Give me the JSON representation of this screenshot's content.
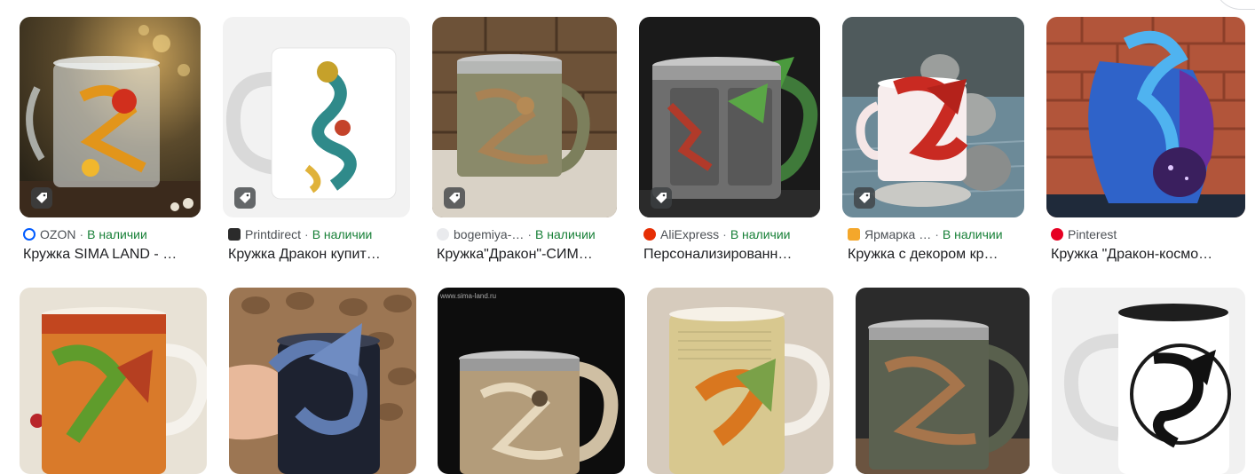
{
  "results_row_1": [
    {
      "source": "OZON",
      "stock": "В наличии",
      "title": "Кружка SIMA LAND - …",
      "image": "glass-mug-golden-dragon",
      "favicon": "ozon-icon"
    },
    {
      "source": "Printdirect",
      "stock": "В наличии",
      "title": "Кружка Дракон купит…",
      "image": "white-mug-teal-dragon",
      "favicon": "printdirect-icon"
    },
    {
      "source": "bogemiya-…",
      "stock": "В наличии",
      "title": "Кружка\"Дракон\"-СИМ…",
      "image": "stone-dragon-tankard",
      "favicon": "bogemiya-icon"
    },
    {
      "source": "AliExpress",
      "stock": "В наличии",
      "title": "Персонализированн…",
      "image": "gothic-dragon-tankard",
      "favicon": "aliexpress-icon"
    },
    {
      "source": "Ярмарка …",
      "stock": "В наличии",
      "title": "Кружка с декором кр…",
      "image": "mug-red-dragon-decor",
      "favicon": "yarmarka-icon"
    },
    {
      "source": "Pinterest",
      "stock": "",
      "title": "Кружка \"Дракон-космо…",
      "image": "blue-cosmic-dragon-mug",
      "favicon": "pinterest-icon"
    }
  ],
  "results_row_2": [
    {
      "image": "green-dragon-porcelain-mug"
    },
    {
      "image": "black-mug-blue-dragon"
    },
    {
      "image": "bone-dragon-tankard",
      "watermark": "www.sima-land.ru"
    },
    {
      "image": "orange-dragon-porcelain-mug"
    },
    {
      "image": "bronze-dragon-tankard"
    },
    {
      "image": "white-mug-black-dragon"
    }
  ],
  "colors": {
    "stock": "#188038",
    "source": "#4d5156",
    "title": "#202124",
    "ozon": "#005bff",
    "aliexpress": "#e62e04",
    "pinterest": "#e60023",
    "yarmarka": "#f4a72b"
  }
}
